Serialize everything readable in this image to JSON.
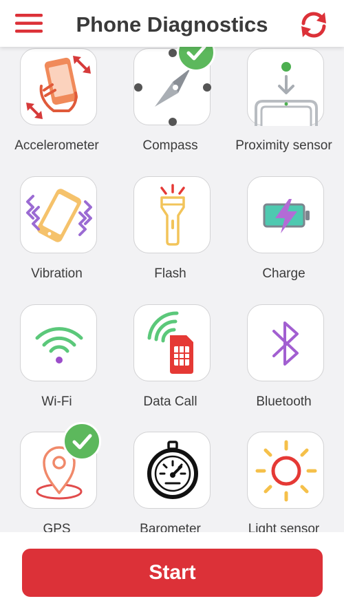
{
  "header": {
    "title": "Phone Diagnostics",
    "menu_icon": "hamburger-menu-icon",
    "refresh_icon": "refresh-icon"
  },
  "colors": {
    "accent_red": "#dc3138",
    "check_green": "#5cb85c"
  },
  "tests": [
    {
      "label": "Accelerometer",
      "icon": "accelerometer-icon",
      "passed": false
    },
    {
      "label": "Compass",
      "icon": "compass-icon",
      "passed": true
    },
    {
      "label": "Proximity sensor",
      "icon": "proximity-sensor-icon",
      "passed": false
    },
    {
      "label": "Vibration",
      "icon": "vibration-icon",
      "passed": false
    },
    {
      "label": "Flash",
      "icon": "flashlight-icon",
      "passed": false
    },
    {
      "label": "Charge",
      "icon": "battery-charge-icon",
      "passed": false
    },
    {
      "label": "Wi-Fi",
      "icon": "wifi-icon",
      "passed": false
    },
    {
      "label": "Data Call",
      "icon": "sim-signal-icon",
      "passed": false
    },
    {
      "label": "Bluetooth",
      "icon": "bluetooth-icon",
      "passed": false
    },
    {
      "label": "GPS",
      "icon": "location-pin-icon",
      "passed": true
    },
    {
      "label": "Barometer",
      "icon": "barometer-icon",
      "passed": false
    },
    {
      "label": "Light sensor",
      "icon": "sun-icon",
      "passed": false
    }
  ],
  "footer": {
    "start_label": "Start"
  }
}
